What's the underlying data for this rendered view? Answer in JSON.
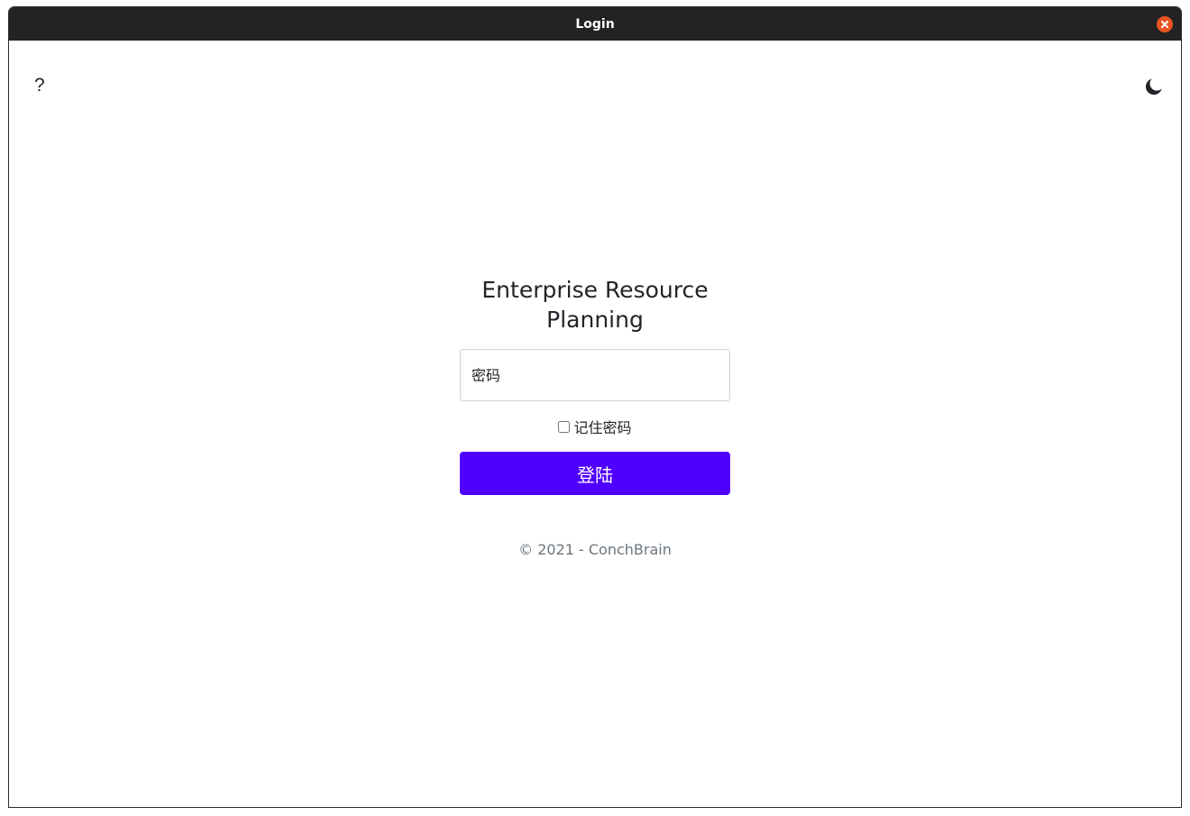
{
  "window": {
    "title": "Login"
  },
  "header": {
    "help_label": "?",
    "theme_icon": "moon-icon"
  },
  "login": {
    "app_title_line1": "Enterprise Resource",
    "app_title_line2": "Planning",
    "password_placeholder": "密码",
    "password_value": "",
    "remember_label": "记住密码",
    "remember_checked": false,
    "submit_label": "登陆"
  },
  "footer": {
    "copyright": "© 2021 - ConchBrain"
  },
  "colors": {
    "titlebar": "#232323",
    "close_button": "#e95420",
    "primary_button": "#5000ff",
    "footer_text": "#6c757d"
  }
}
